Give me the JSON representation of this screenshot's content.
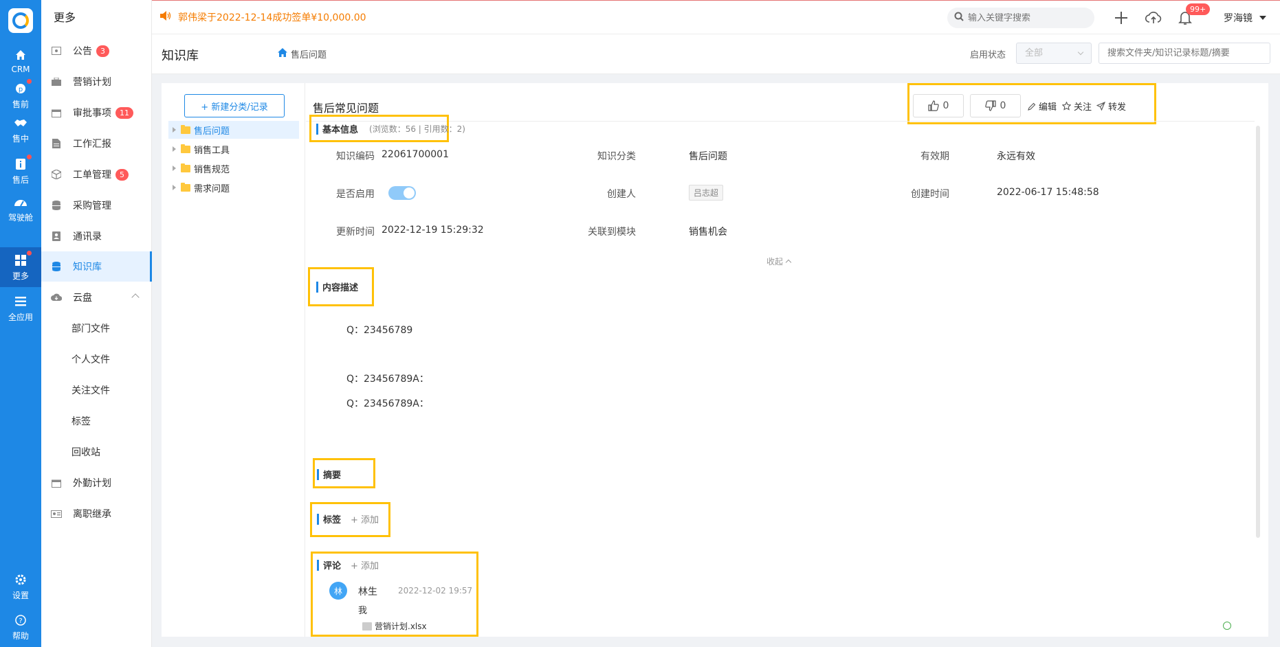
{
  "rail": {
    "items": [
      {
        "label": "CRM",
        "icon": "home-icon"
      },
      {
        "label": "售前",
        "icon": "pinterest-icon",
        "dot": true
      },
      {
        "label": "售中",
        "icon": "handshake-icon"
      },
      {
        "label": "售后",
        "icon": "info-icon",
        "dot": true
      },
      {
        "label": "驾驶舱",
        "icon": "dashboard-icon"
      },
      {
        "label": "更多",
        "icon": "grid-icon",
        "dot": true,
        "active": true
      },
      {
        "label": "全应用",
        "icon": "list-icon"
      },
      {
        "label": "设置",
        "icon": "gear-icon"
      },
      {
        "label": "帮助",
        "icon": "help-icon"
      }
    ]
  },
  "sidebar": {
    "title": "更多",
    "items": [
      {
        "label": "公告",
        "badge": "3"
      },
      {
        "label": "营销计划"
      },
      {
        "label": "审批事项",
        "badge": "11"
      },
      {
        "label": "工作汇报"
      },
      {
        "label": "工单管理",
        "badge": "5"
      },
      {
        "label": "采购管理"
      },
      {
        "label": "通讯录"
      },
      {
        "label": "知识库"
      },
      {
        "label": "云盘"
      },
      {
        "label": "部门文件"
      },
      {
        "label": "个人文件"
      },
      {
        "label": "关注文件"
      },
      {
        "label": "标签"
      },
      {
        "label": "回收站"
      },
      {
        "label": "外勤计划"
      },
      {
        "label": "离职继承"
      }
    ]
  },
  "topbar": {
    "announcement": "郭伟梁于2022-12-14成功签单¥10,000.00",
    "search_placeholder": "输入关键字搜索",
    "notif_count": "99+",
    "user": "罗海镜"
  },
  "pagehead": {
    "title": "知识库",
    "breadcrumb": "售后问题",
    "status_label": "启用状态",
    "status_value": "全部",
    "keyword_placeholder": "搜索文件夹/知识记录标题/摘要"
  },
  "tree": {
    "new_button": "+ 新建分类/记录",
    "nodes": [
      "售后问题",
      "销售工具",
      "销售规范",
      "需求问题"
    ]
  },
  "doc": {
    "title": "售后常见问题",
    "likes": "0",
    "dislikes": "0",
    "edit": "编辑",
    "follow": "关注",
    "forward": "转发",
    "basic_info": {
      "heading": "基本信息",
      "meta": "(浏览数：56 | 引用数：2)",
      "code_label": "知识编码",
      "code": "22061700001",
      "category_label": "知识分类",
      "category": "售后问题",
      "validity_label": "有效期",
      "validity": "永远有效",
      "enabled_label": "是否启用",
      "creator_label": "创建人",
      "creator": "吕志超",
      "created_label": "创建时间",
      "created": "2022-06-17 15:48:58",
      "updated_label": "更新时间",
      "updated": "2022-12-19 15:29:32",
      "module_label": "关联到模块",
      "module": "销售机会",
      "collapse": "收起"
    },
    "content": {
      "heading": "内容描述",
      "lines": [
        "Q：23456789",
        "Q：23456789A：",
        "Q：23456789A："
      ]
    },
    "summary": {
      "heading": "摘要"
    },
    "tags": {
      "heading": "标签",
      "add": "+ 添加"
    },
    "comments": {
      "heading": "评论",
      "add": "+ 添加",
      "author_initial": "林",
      "author": "林生",
      "time": "2022-12-02 19:57",
      "text": "我",
      "attachment": "营销计划.xlsx"
    }
  },
  "colors": {
    "primary": "#1e88e5",
    "highlight": "#ffc107",
    "announce": "#f57c00",
    "badge": "#ff5a5a"
  }
}
